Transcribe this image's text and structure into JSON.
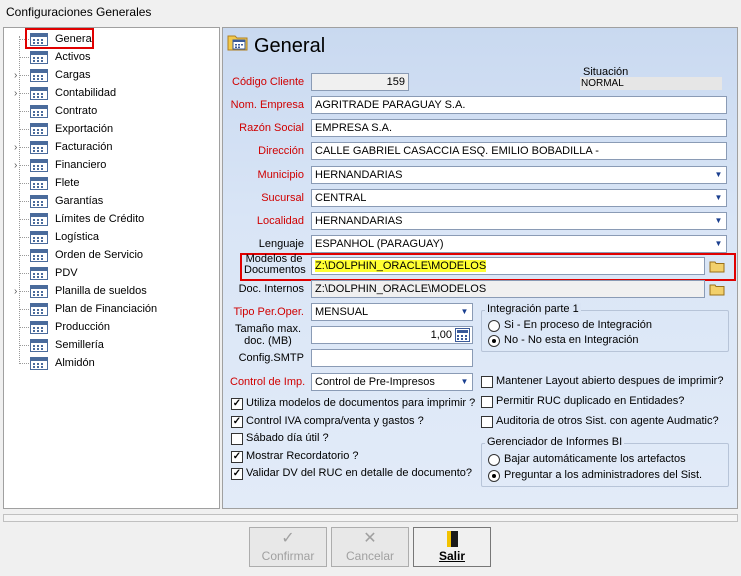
{
  "window": {
    "title": "Configuraciones Generales"
  },
  "tree": {
    "items": [
      {
        "label": "General",
        "expandable": false,
        "selected": true
      },
      {
        "label": "Activos",
        "expandable": false
      },
      {
        "label": "Cargas",
        "expandable": true
      },
      {
        "label": "Contabilidad",
        "expandable": true
      },
      {
        "label": "Contrato",
        "expandable": false
      },
      {
        "label": "Exportación",
        "expandable": false
      },
      {
        "label": "Facturación",
        "expandable": true
      },
      {
        "label": "Financiero",
        "expandable": true
      },
      {
        "label": "Flete",
        "expandable": false
      },
      {
        "label": "Garantías",
        "expandable": false
      },
      {
        "label": "Límites de Crédito",
        "expandable": false
      },
      {
        "label": "Logística",
        "expandable": false
      },
      {
        "label": "Orden de Servicio",
        "expandable": false
      },
      {
        "label": "PDV",
        "expandable": false
      },
      {
        "label": "Planilla de sueldos",
        "expandable": true
      },
      {
        "label": "Plan de Financiación",
        "expandable": false
      },
      {
        "label": "Producción",
        "expandable": false
      },
      {
        "label": "Semillería",
        "expandable": false
      },
      {
        "label": "Almidón",
        "expandable": false
      }
    ],
    "expand_glyph": "›"
  },
  "panel": {
    "title": "General",
    "icon": "folder-calendar-icon"
  },
  "form": {
    "codigo_cliente": {
      "label": "Código Cliente",
      "value": "159"
    },
    "situacion": {
      "label": "Situación",
      "value": "NORMAL"
    },
    "nom_empresa": {
      "label": "Nom. Empresa",
      "value": "AGRITRADE PARAGUAY S.A."
    },
    "razon_social": {
      "label": "Razón Social",
      "value": "EMPRESA S.A."
    },
    "direccion": {
      "label": "Dirección",
      "value": "CALLE GABRIEL CASACCIA ESQ. EMILIO BOBADILLA -"
    },
    "municipio": {
      "label": "Municipio",
      "value": "HERNANDARIAS"
    },
    "sucursal": {
      "label": "Sucursal",
      "value": "CENTRAL"
    },
    "localidad": {
      "label": "Localidad",
      "value": "HERNANDARIAS"
    },
    "lenguaje": {
      "label": "Lenguaje",
      "value": "ESPANHOL (PARAGUAY)"
    },
    "modelos_documentos": {
      "label_line1": "Modelos de",
      "label_line2": "Documentos",
      "value": "Z:\\DOLPHIN_ORACLE\\MODELOS"
    },
    "doc_internos": {
      "label": "Doc. Internos",
      "value": "Z:\\DOLPHIN_ORACLE\\MODELOS"
    },
    "tipo_per_oper": {
      "label": "Tipo Per.Oper.",
      "value": "MENSUAL"
    },
    "tamano_max": {
      "label_line1": "Tamaño max.",
      "label_line2": "doc. (MB)",
      "value": "1,00"
    },
    "config_smtp": {
      "label": "Config.SMTP",
      "value": ""
    },
    "control_imp": {
      "label": "Control de Imp.",
      "value": "Control de Pre-Impresos"
    }
  },
  "integracion": {
    "title": "Integración parte 1",
    "options": [
      {
        "label": "Si - En proceso de Integración",
        "selected": false
      },
      {
        "label": "No - No esta en Integración",
        "selected": true
      }
    ]
  },
  "checks_left": [
    {
      "label": "Utiliza modelos de documentos para imprimir ?",
      "checked": true
    },
    {
      "label": "Control IVA compra/venta y gastos ?",
      "checked": true
    },
    {
      "label": "Sábado día útil ?",
      "checked": false
    },
    {
      "label": "Mostrar Recordatorio ?",
      "checked": true
    },
    {
      "label": "Validar DV del RUC en detalle de documento?",
      "checked": true
    }
  ],
  "checks_right": [
    {
      "label": "Mantener Layout abierto despues de imprimir?",
      "checked": false
    },
    {
      "label": "Permitir RUC duplicado en Entidades?",
      "checked": false
    },
    {
      "label": "Auditoria de otros Sist. con agente Audmatic?",
      "checked": false
    }
  ],
  "gerenciador": {
    "title": "Gerenciador de Informes BI",
    "options": [
      {
        "label": "Bajar automáticamente los artefactos",
        "selected": false
      },
      {
        "label": "Preguntar a los administradores del Sist.",
        "selected": true
      }
    ]
  },
  "buttons": {
    "confirmar": {
      "label": "Confirmar",
      "icon": "check-icon",
      "enabled": false
    },
    "cancelar": {
      "label": "Cancelar",
      "icon": "x-icon",
      "enabled": false
    },
    "salir": {
      "label": "Salir",
      "icon": "exit-door-icon",
      "enabled": true
    }
  },
  "colors": {
    "required_label": "#d00000",
    "highlight_box": "#e00000",
    "path_highlight": "#ffff33",
    "panel_bg": "#d9e5f6"
  }
}
